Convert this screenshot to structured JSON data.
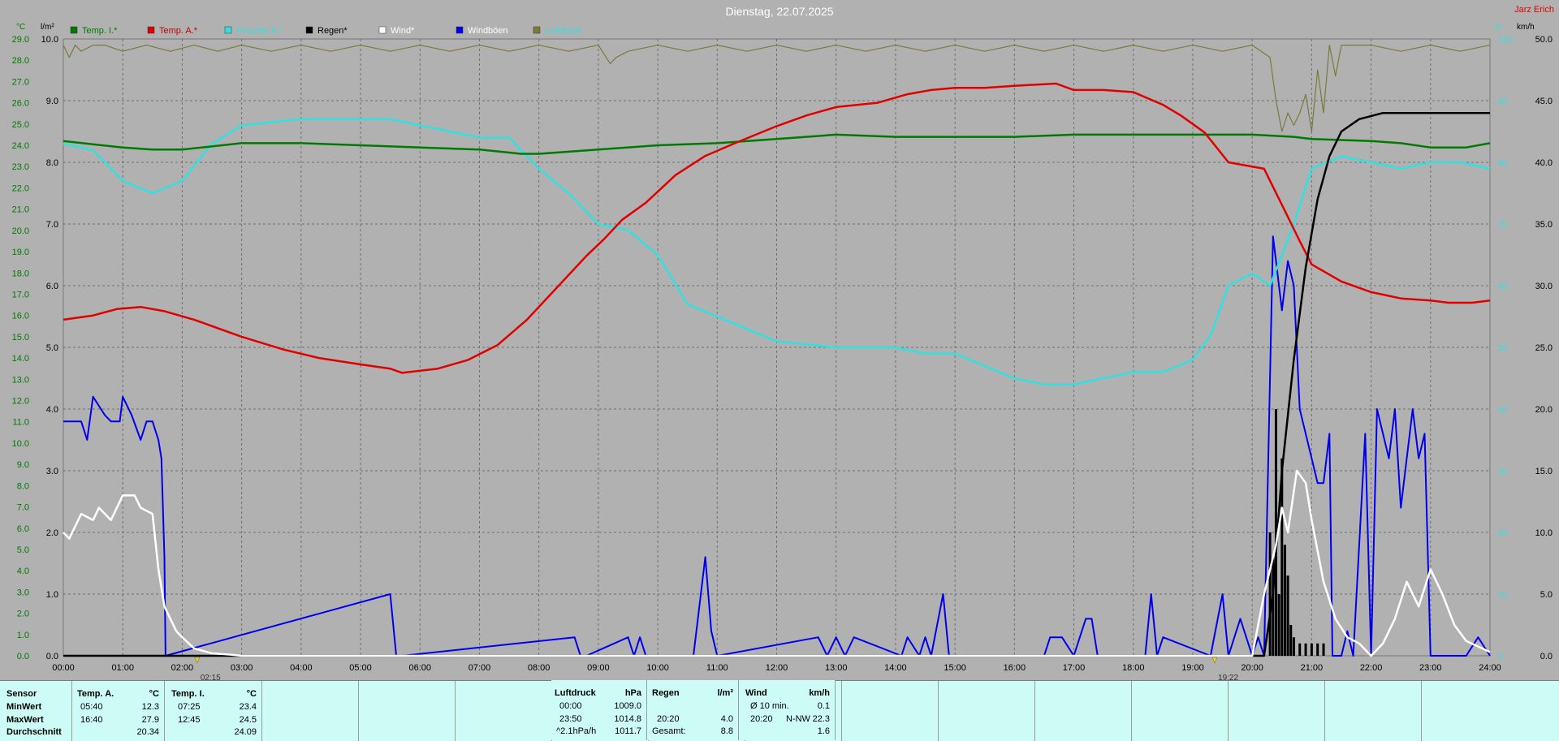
{
  "header": {
    "title": "Dienstag, 22.07.2025",
    "station": "Jarz Erich",
    "unit_left": "°C",
    "unit_rain": "l/m²",
    "unit_pct": "%",
    "unit_wind": "km/h"
  },
  "legend": [
    {
      "label": "Temp. I.*",
      "color": "#007a00",
      "text_color": "#007a00"
    },
    {
      "label": "Temp. A.*",
      "color": "#e00000",
      "text_color": "#c80000"
    },
    {
      "label": "Feuchte A.*",
      "color": "#33e0e0",
      "text_color": "#33e0e0"
    },
    {
      "label": "Regen*",
      "color": "#000000",
      "text_color": "#000000"
    },
    {
      "label": "Wind*",
      "color": "#ffffff",
      "text_color": "#ffffff"
    },
    {
      "label": "Windböen",
      "color": "#0000ee",
      "text_color": "#ffffff"
    },
    {
      "label": "Luftdruck",
      "color": "#7a7a3a",
      "text_color": "#33e0e0"
    }
  ],
  "markers": [
    {
      "hour": 2.25,
      "label": "02:15"
    },
    {
      "hour": 19.37,
      "label": "19:22"
    }
  ],
  "chart_data": {
    "type": "line",
    "x_unit": "hour",
    "xlim": [
      0,
      24
    ],
    "x_ticks": [
      "00:00",
      "01:00",
      "02:00",
      "03:00",
      "04:00",
      "05:00",
      "06:00",
      "07:00",
      "08:00",
      "09:00",
      "10:00",
      "11:00",
      "12:00",
      "13:00",
      "14:00",
      "15:00",
      "16:00",
      "17:00",
      "18:00",
      "19:00",
      "20:00",
      "21:00",
      "22:00",
      "23:00",
      "24:00"
    ],
    "temp_axis": {
      "range": [
        0,
        29
      ],
      "ticks": [
        "0.0",
        "1.0",
        "2.0",
        "3.0",
        "4.0",
        "5.0",
        "6.0",
        "7.0",
        "8.0",
        "9.0",
        "10.0",
        "11.0",
        "12.0",
        "13.0",
        "14.0",
        "15.0",
        "16.0",
        "17.0",
        "18.0",
        "19.0",
        "20.0",
        "21.0",
        "22.0",
        "23.0",
        "24.0",
        "25.0",
        "26.0",
        "27.0",
        "28.0",
        "29.0"
      ]
    },
    "rain_axis": {
      "range": [
        0,
        10
      ],
      "ticks": [
        "0.0",
        "1.0",
        "2.0",
        "3.0",
        "4.0",
        "5.0",
        "6.0",
        "7.0",
        "8.0",
        "9.0",
        "10.0"
      ]
    },
    "pct_axis": {
      "range": [
        0,
        100
      ],
      "ticks": [
        "0",
        "10",
        "20",
        "30",
        "40",
        "50",
        "60",
        "70",
        "80",
        "90",
        "100"
      ]
    },
    "wind_axis": {
      "range": [
        0,
        50
      ],
      "ticks": [
        "0.0",
        "5.0",
        "10.0",
        "15.0",
        "20.0",
        "25.0",
        "30.0",
        "35.0",
        "40.0",
        "45.0",
        "50.0"
      ]
    },
    "series": [
      {
        "name": "Temp. I.*",
        "axis": "temp",
        "color": "#007a00",
        "x": [
          0,
          1,
          1.5,
          2,
          3,
          4,
          5,
          6,
          7,
          7.7,
          8,
          9,
          10,
          11,
          12,
          13,
          14,
          15,
          16,
          17,
          18,
          18.8,
          19.5,
          20,
          20.7,
          21,
          22,
          22.5,
          23,
          23.6,
          24
        ],
        "y": [
          24.2,
          23.9,
          23.8,
          23.8,
          24.1,
          24.1,
          24.0,
          23.9,
          23.8,
          23.6,
          23.6,
          23.8,
          24.0,
          24.1,
          24.3,
          24.5,
          24.4,
          24.4,
          24.4,
          24.5,
          24.5,
          24.5,
          24.5,
          24.5,
          24.4,
          24.3,
          24.2,
          24.1,
          23.9,
          23.9,
          24.1
        ]
      },
      {
        "name": "Temp. A.*",
        "axis": "temp",
        "color": "#e00000",
        "x": [
          0,
          0.5,
          0.9,
          1.3,
          1.7,
          2.2,
          3,
          3.7,
          4.3,
          5,
          5.5,
          5.7,
          6.3,
          6.8,
          7.3,
          7.8,
          8.3,
          8.8,
          9.1,
          9.4,
          9.8,
          10.3,
          10.8,
          11.3,
          12,
          12.5,
          13,
          13.7,
          14.2,
          14.6,
          15,
          15.5,
          16,
          16.7,
          17,
          17.5,
          18,
          18.5,
          18.8,
          19.2,
          19.6,
          20.2,
          20.5,
          20.8,
          21,
          21.5,
          22,
          22.5,
          23,
          23.3,
          23.7,
          24
        ],
        "y": [
          15.8,
          16.0,
          16.3,
          16.4,
          16.2,
          15.8,
          15.0,
          14.4,
          14.0,
          13.7,
          13.5,
          13.3,
          13.5,
          13.9,
          14.6,
          15.8,
          17.3,
          18.8,
          19.6,
          20.5,
          21.3,
          22.6,
          23.5,
          24.1,
          24.9,
          25.4,
          25.8,
          26.0,
          26.4,
          26.6,
          26.7,
          26.7,
          26.8,
          26.9,
          26.6,
          26.6,
          26.5,
          25.9,
          25.4,
          24.6,
          23.2,
          22.9,
          21.2,
          19.5,
          18.4,
          17.6,
          17.1,
          16.8,
          16.7,
          16.6,
          16.6,
          16.7
        ]
      },
      {
        "name": "Feuchte A.*",
        "axis": "pct",
        "color": "#33e0e0",
        "x": [
          0,
          0.5,
          1,
          1.5,
          2,
          2.5,
          3,
          4,
          5,
          5.5,
          6,
          6.5,
          7,
          7.5,
          8,
          8.5,
          9,
          9.5,
          10,
          10.5,
          11,
          11.5,
          12,
          13,
          14,
          14.5,
          15,
          15.5,
          16,
          16.5,
          17,
          17.5,
          18,
          18.5,
          19,
          19.3,
          19.6,
          20,
          20.3,
          20.7,
          21,
          21.5,
          22,
          22.5,
          23,
          23.5,
          24
        ],
        "y": [
          83,
          82,
          77,
          75,
          77,
          83,
          86,
          87,
          87,
          87,
          86,
          85,
          84,
          84,
          79,
          75,
          70,
          69,
          65,
          57,
          55,
          53,
          51,
          50,
          50,
          49,
          49,
          47,
          45,
          44,
          44,
          45,
          46,
          46,
          48,
          52,
          60,
          62,
          60,
          70,
          79,
          81,
          80,
          79,
          80,
          80,
          79
        ]
      },
      {
        "name": "Regen*",
        "axis": "rain",
        "color": "#000000",
        "x": [
          0,
          20.2,
          20.35,
          20.5,
          20.7,
          20.9,
          21.1,
          21.3,
          21.5,
          21.8,
          22.2,
          23,
          24
        ],
        "y": [
          0,
          0,
          1.0,
          3.0,
          4.8,
          6.3,
          7.4,
          8.1,
          8.5,
          8.7,
          8.8,
          8.8,
          8.8
        ]
      },
      {
        "name": "Wind*",
        "axis": "wind",
        "color": "#ffffff",
        "x": [
          0,
          0.1,
          0.3,
          0.5,
          0.6,
          0.8,
          1.0,
          1.2,
          1.3,
          1.5,
          1.6,
          1.7,
          1.8,
          1.9,
          2.0,
          2.2,
          2.5,
          2.8,
          3.0,
          3.2,
          20.0,
          20.2,
          20.4,
          20.5,
          20.6,
          20.75,
          20.9,
          21.0,
          21.2,
          21.4,
          21.6,
          21.8,
          22.0,
          22.2,
          22.4,
          22.6,
          22.8,
          23.0,
          23.2,
          23.4,
          23.6,
          24
        ],
        "y": [
          10,
          9.5,
          11.5,
          11,
          12,
          11,
          13,
          13,
          12,
          11.5,
          7,
          4,
          3,
          2,
          1.5,
          0.6,
          0.2,
          0.1,
          0,
          0,
          0,
          5,
          9,
          12,
          10,
          15,
          14,
          11,
          6,
          3,
          1.5,
          1,
          0,
          1,
          3,
          6,
          4,
          7,
          5,
          2.5,
          1.2,
          0.3
        ]
      },
      {
        "name": "Windböen",
        "axis": "wind",
        "color": "#0000ee",
        "x": [
          0,
          0.2,
          0.3,
          0.4,
          0.5,
          0.7,
          0.8,
          0.95,
          1.0,
          1.15,
          1.3,
          1.4,
          1.5,
          1.6,
          1.65,
          1.7,
          1.72,
          5.5,
          5.6,
          5.7,
          8.6,
          8.7,
          8.8,
          9.5,
          9.6,
          9.7,
          9.8,
          9.9,
          10.6,
          10.8,
          10.9,
          11.0,
          12.7,
          12.85,
          13.0,
          13.15,
          13.3,
          14.1,
          14.2,
          14.4,
          14.5,
          14.6,
          14.8,
          14.9,
          16.5,
          16.6,
          16.8,
          17.0,
          17.2,
          17.3,
          17.4,
          17.6,
          18.2,
          18.3,
          18.4,
          18.5,
          19.3,
          19.5,
          19.6,
          19.8,
          20.0,
          20.1,
          20.2,
          20.35,
          20.5,
          20.6,
          20.7,
          20.8,
          21.0,
          21.1,
          21.2,
          21.3,
          21.35,
          21.5,
          21.6,
          21.7,
          21.9,
          22.0,
          22.1,
          22.3,
          22.4,
          22.5,
          22.7,
          22.8,
          22.9,
          23.0,
          23.1,
          23.3,
          23.5,
          23.6,
          23.8,
          24
        ],
        "y": [
          19,
          19,
          19,
          17.5,
          21,
          19.5,
          19,
          19,
          21,
          19.5,
          17.5,
          19,
          19,
          17.5,
          16,
          8,
          0,
          5,
          0,
          0,
          1.5,
          0,
          0,
          1.5,
          0,
          1.5,
          0,
          0,
          0,
          8,
          2,
          0,
          1.5,
          0,
          1.5,
          0,
          1.5,
          0,
          1.5,
          0,
          1.5,
          0,
          5,
          0,
          0,
          1.5,
          1.5,
          0,
          3,
          3,
          0,
          0,
          0,
          5,
          0,
          1.5,
          0,
          5,
          0,
          3,
          0,
          1.5,
          0,
          34,
          28,
          32,
          30,
          20,
          16,
          14,
          14,
          18,
          0,
          0,
          2,
          0,
          18,
          0,
          20,
          16,
          20,
          12,
          20,
          16,
          18,
          0,
          0,
          0,
          0,
          0,
          1.5,
          0
        ]
      },
      {
        "name": "Luftdruck",
        "axis": "pct",
        "color": "#7a7a3a",
        "x": [
          0,
          0.1,
          0.2,
          0.3,
          0.5,
          0.7,
          1,
          1.4,
          1.8,
          2.2,
          2.6,
          3,
          3.5,
          4,
          4.5,
          5,
          5.5,
          6,
          6.5,
          7,
          7.5,
          8,
          8.5,
          9,
          9.2,
          9.3,
          9.5,
          10,
          10.5,
          11,
          11.5,
          12,
          12.5,
          13,
          13.5,
          14,
          14.5,
          15,
          15.5,
          16,
          16.5,
          17,
          17.5,
          18,
          18.5,
          19,
          19.5,
          20,
          20.3,
          20.4,
          20.5,
          20.6,
          20.7,
          20.8,
          20.9,
          21.0,
          21.1,
          21.2,
          21.3,
          21.4,
          21.5,
          22,
          22.5,
          23,
          23.5,
          24
        ],
        "y": [
          99,
          97,
          99,
          98,
          99,
          99,
          98,
          99,
          98,
          99,
          98,
          99,
          98,
          99,
          98,
          99,
          98,
          99,
          98,
          99,
          98,
          99,
          98,
          99,
          96,
          97,
          98,
          99,
          98,
          99,
          98,
          99,
          98,
          99,
          98,
          99,
          98,
          99,
          98,
          99,
          98,
          99,
          98,
          99,
          98,
          99,
          98,
          99,
          97,
          90,
          85,
          88,
          86,
          88,
          91,
          85,
          95,
          88,
          99,
          94,
          99,
          99,
          98,
          99,
          98,
          99
        ]
      },
      {
        "name": "Regen (Intervall)",
        "axis": "rain",
        "color": "#000000",
        "type": "bar",
        "x": [
          20.3,
          20.35,
          20.4,
          20.45,
          20.5,
          20.55,
          20.6,
          20.65,
          20.7,
          20.8,
          20.9,
          21.0,
          21.1,
          21.2
        ],
        "y": [
          2.0,
          1.6,
          4.0,
          1.0,
          3.2,
          1.8,
          1.3,
          0.5,
          0.3,
          0.2,
          0.2,
          0.2,
          0.2,
          0.2
        ]
      }
    ]
  },
  "stats": {
    "sensor_col": {
      "header": "Sensor",
      "min": "MinWert",
      "max": "MaxWert",
      "avg": "Durchschnitt"
    },
    "temp_a": {
      "header": "Temp. A.",
      "unit": "°C",
      "min_time": "05:40",
      "min_val": "12.3",
      "max_time": "16:40",
      "max_val": "27.9",
      "avg_val": "20.34"
    },
    "temp_i": {
      "header": "Temp. I.",
      "unit": "°C",
      "min_time": "07:25",
      "min_val": "23.4",
      "max_time": "12:45",
      "max_val": "24.5",
      "avg_val": "24.09"
    },
    "pressure": {
      "header": "Luftdruck",
      "unit": "hPa",
      "r1_time": "00:00",
      "r1_val": "1009.0",
      "r2_time": "23:50",
      "r2_val": "1014.8",
      "r3_time": "^2.1hPa/h",
      "r3_val": "1011.7"
    },
    "rain": {
      "header": "Regen",
      "unit": "l/m²",
      "r2_time": "20:20",
      "r2_val": "4.0",
      "r3_label": "Gesamt:",
      "r3_val": "8.8"
    },
    "wind": {
      "header": "Wind",
      "unit": "km/h",
      "r1_label": "Ø 10 min.",
      "r1_val": "0.1",
      "r2_time": "20:20",
      "r2_label": "N-NW",
      "r2_val": "22.3",
      "r3_val": "1.6"
    }
  }
}
